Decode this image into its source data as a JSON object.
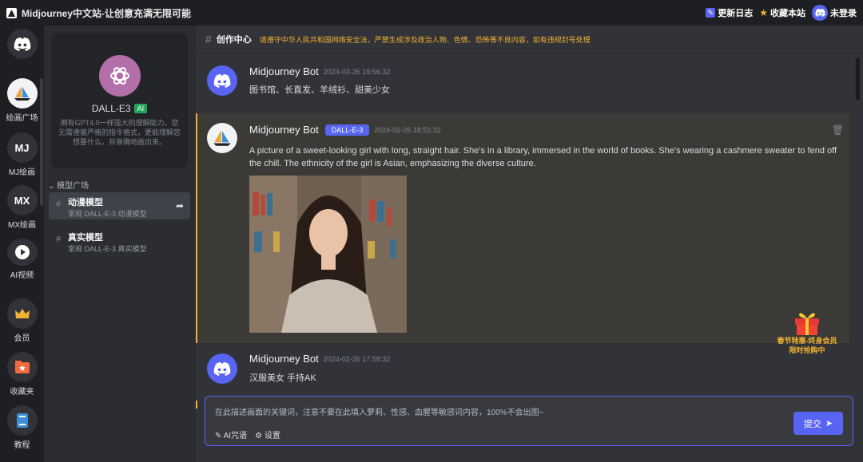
{
  "app": {
    "title": "Midjourney中文站-让创意充满无限可能"
  },
  "topbar": {
    "changelog": "更新日志",
    "bookmark": "收藏本站",
    "login": "未登录"
  },
  "rail": {
    "items": [
      {
        "label": "",
        "icon": "discord-icon"
      },
      {
        "label": "绘画广场",
        "icon": "sailboat-icon"
      },
      {
        "label": "MJ绘画",
        "glyph": "MJ"
      },
      {
        "label": "MX绘画",
        "glyph": "MX"
      },
      {
        "label": "AI视频",
        "icon": "play-icon"
      },
      {
        "label": "会员",
        "icon": "crown-icon"
      },
      {
        "label": "收藏夹",
        "icon": "star-folder-icon"
      },
      {
        "label": "教程",
        "icon": "book-icon"
      }
    ]
  },
  "panel": {
    "model_name": "DALL-E3",
    "ai_badge": "AI",
    "description": "拥有GPT4.0一样强大的理解能力，您无需遵循严格的指令格式，更能理解您想要什么，并准确地画出来。",
    "section": "模型广场",
    "models": [
      {
        "title": "动漫模型",
        "subtitle": "常规 DALL-E-3 动漫模型"
      },
      {
        "title": "真实模型",
        "subtitle": "常规 DALL-E-3 真实模型"
      }
    ]
  },
  "channel": {
    "name": "创作中心",
    "notice": "请遵守中华人民共和国网络安全法，严禁生成涉及政治人物、色情、恐怖等不良内容，如有违规封号处理"
  },
  "messages": [
    {
      "author": "Midjourney Bot",
      "time": "2024-02-26 19:56:32",
      "text": "图书馆、长直发、羊绒衫、甜美少女"
    },
    {
      "author": "Midjourney Bot",
      "tag": "DALL-E-3",
      "time": "2024-02-26 18:51:32",
      "text": "A picture of a sweet-looking girl with long, straight hair. She's in a library, immersed in the world of books. She's wearing a cashmere sweater to fend off the chill. The ethnicity of the girl is Asian, emphasizing the diverse culture."
    },
    {
      "author": "Midjourney Bot",
      "time": "2024-02-26 17:58:32",
      "text": "汉服美女 手持AK"
    }
  ],
  "promo": {
    "line1": "春节特惠-终身会员",
    "line2": "限时抢购中"
  },
  "composer": {
    "placeholder": "在此描述画面的关键词，注意不要在此填入萝莉、性感、血腥等敏感词内容，100%不会出图~",
    "ai_prompt": "AI咒语",
    "settings": "设置",
    "submit": "提交"
  },
  "colors": {
    "accent": "#5865f2",
    "warning": "#f0b232",
    "background": "#313338"
  }
}
